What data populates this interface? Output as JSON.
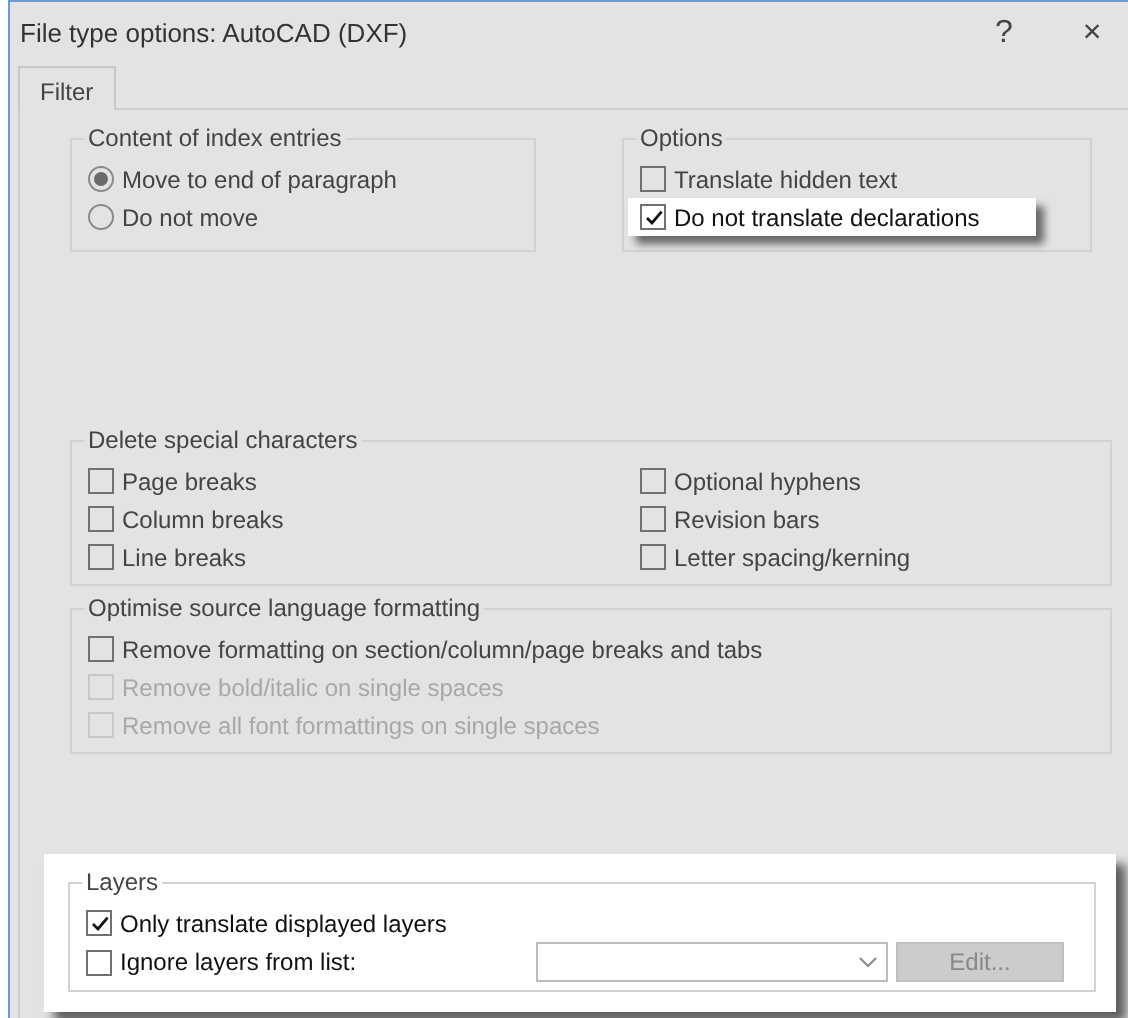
{
  "window": {
    "title": "File type options: AutoCAD (DXF)",
    "help": "?",
    "close": "×"
  },
  "tabs": [
    {
      "label": "Filter",
      "selected": true
    }
  ],
  "top_groups": [
    {
      "title": "Content of index entries",
      "items": [
        {
          "kind": "radio",
          "label": "Move to end of paragraph",
          "selected": true,
          "highlighted": false
        },
        {
          "kind": "radio",
          "label": "Do not move",
          "selected": false,
          "highlighted": false
        }
      ]
    },
    {
      "title": "Options",
      "items": [
        {
          "kind": "checkbox",
          "label": "Translate hidden text",
          "checked": false,
          "highlighted": false
        },
        {
          "kind": "checkbox",
          "label": "Do not translate declarations",
          "checked": true,
          "highlighted": true
        }
      ]
    }
  ],
  "delete_special_characters": {
    "title": "Delete special characters",
    "items": [
      {
        "label": "Page breaks",
        "checked": false
      },
      {
        "label": "Optional hyphens",
        "checked": false
      },
      {
        "label": "Column breaks",
        "checked": false
      },
      {
        "label": "Revision bars",
        "checked": false
      },
      {
        "label": "Line breaks",
        "checked": false
      },
      {
        "label": "Letter spacing/kerning",
        "checked": false
      }
    ]
  },
  "optimise": {
    "title": "Optimise source language formatting",
    "items": [
      {
        "label": "Remove formatting on section/column/page breaks and tabs",
        "checked": false,
        "disabled": false
      },
      {
        "label": "Remove bold/italic on single spaces",
        "checked": false,
        "disabled": true
      },
      {
        "label": "Remove all font formattings on single spaces",
        "checked": false,
        "disabled": true
      }
    ]
  },
  "layers": {
    "title": "Layers",
    "highlighted": true,
    "items": [
      {
        "label": "Only translate displayed layers",
        "checked": true
      },
      {
        "label": "Ignore layers from list:",
        "checked": false
      }
    ],
    "dropdown": {
      "disabled": false
    },
    "edit_button": {
      "label": "Edit...",
      "disabled": true
    }
  }
}
